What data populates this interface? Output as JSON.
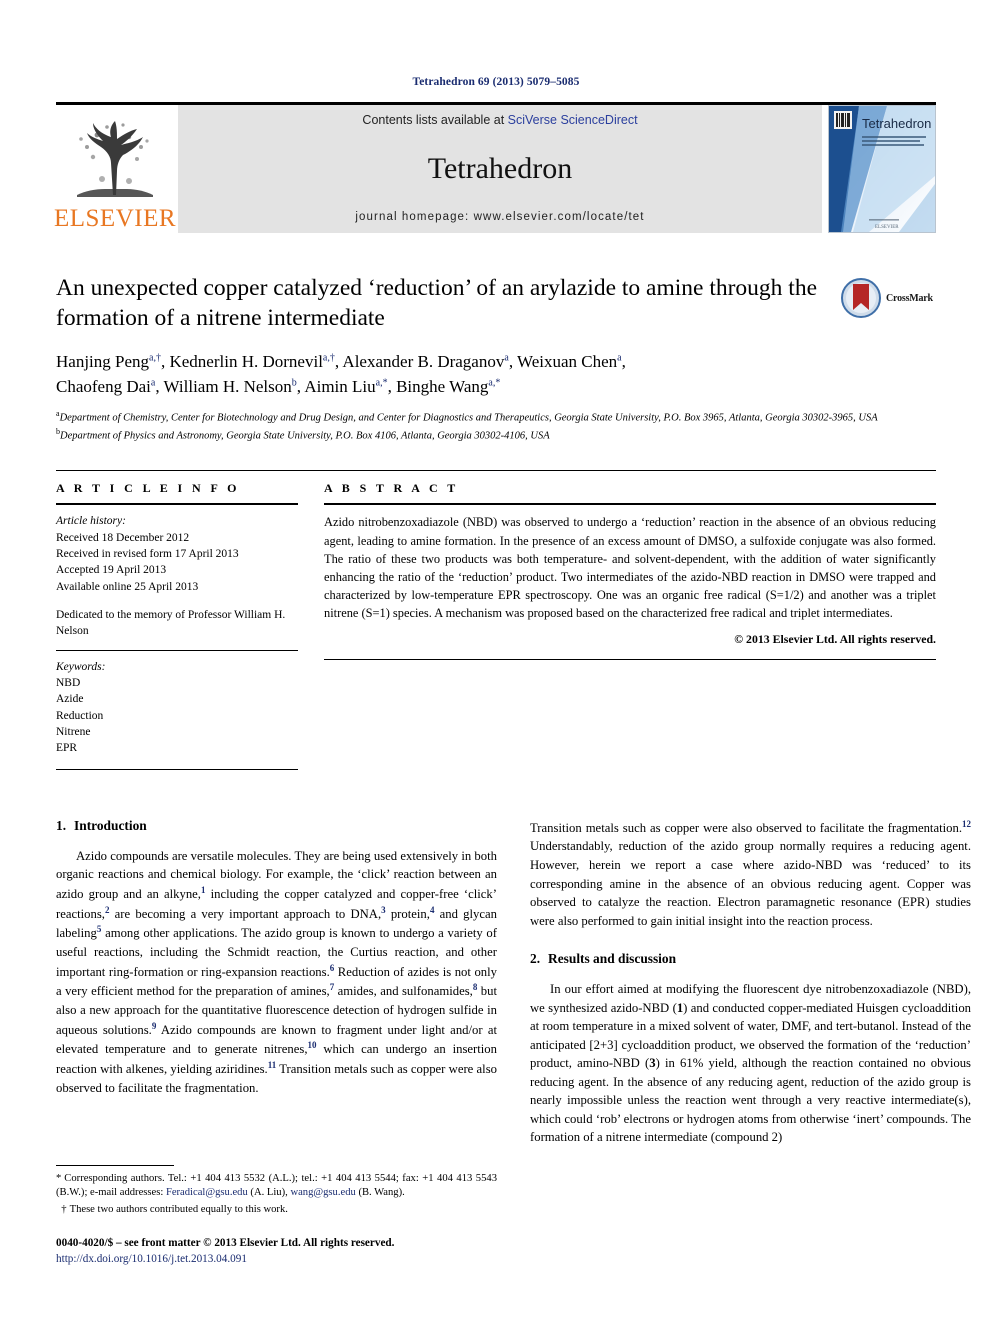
{
  "running_head": "Tetrahedron 69 (2013) 5079–5085",
  "masthead": {
    "publisher_name": "ELSEVIER",
    "contents_prefix": "Contents lists available at ",
    "contents_link": "SciVerse ScienceDirect",
    "journal_title": "Tetrahedron",
    "homepage": "journal homepage: www.elsevier.com/locate/tet",
    "cover_title": "Tetrahedron",
    "cover_subtitle": "THE INTERNATIONAL JOURNAL FOR THE RAPID PUBLICATION OF FULL ORIGINAL RESEARCH PAPERS AND CRITICAL REVIEWS IN ORGANIC CHEMISTRY",
    "cover_footer": "ELSEVIER"
  },
  "article": {
    "title": "An unexpected copper catalyzed ‘reduction’ of an arylazide to amine through the formation of a nitrene intermediate",
    "crossmark_label": "CrossMark",
    "authors_line1": "Hanjing Peng a,†, Kednerlin H. Dornevil a,†, Alexander B. Draganov a, Weixuan Chen a,",
    "authors_line2": "Chaofeng Dai a, William H. Nelson b, Aimin Liu a,*, Binghe Wang a,*",
    "affiliation_a": "a Department of Chemistry, Center for Biotechnology and Drug Design, and Center for Diagnostics and Therapeutics, Georgia State University, P.O. Box 3965, Atlanta, Georgia 30302-3965, USA",
    "affiliation_b": "b Department of Physics and Astronomy, Georgia State University, P.O. Box 4106, Atlanta, Georgia 30302-4106, USA"
  },
  "article_info": {
    "heading": "A R T I C L E   I N F O",
    "history_label": "Article history:",
    "history": [
      "Received 18 December 2012",
      "Received in revised form 17 April 2013",
      "Accepted 19 April 2013",
      "Available online 25 April 2013"
    ],
    "dedication": "Dedicated to the memory of Professor William H. Nelson",
    "keywords_label": "Keywords:",
    "keywords": [
      "NBD",
      "Azide",
      "Reduction",
      "Nitrene",
      "EPR"
    ]
  },
  "abstract": {
    "heading": "A B S T R A C T",
    "text": "Azido nitrobenzoxadiazole (NBD) was observed to undergo a ‘reduction’ reaction in the absence of an obvious reducing agent, leading to amine formation. In the presence of an excess amount of DMSO, a sulfoxide conjugate was also formed. The ratio of these two products was both temperature- and solvent-dependent, with the addition of water significantly enhancing the ratio of the ‘reduction’ product. Two intermediates of the azido-NBD reaction in DMSO were trapped and characterized by low-temperature EPR spectroscopy. One was an organic free radical (S=1/2) and another was a triplet nitrene (S=1) species. A mechanism was proposed based on the characterized free radical and triplet intermediates.",
    "copyright": "© 2013 Elsevier Ltd. All rights reserved."
  },
  "sections": {
    "intro_number": "1.",
    "intro_title": "Introduction",
    "intro_p1_a": "Azido compounds are versatile molecules. They are being used extensively in both organic reactions and chemical biology. For example, the ‘click’ reaction between an azido group and an alkyne,",
    "intro_p1_b": " including the copper catalyzed and copper-free ‘click’ reactions,",
    "intro_p1_c": " are becoming a very important approach to DNA,",
    "intro_p1_d": " protein,",
    "intro_p1_e": " and glycan labeling",
    "intro_p1_f": " among other applications. The azido group is known to undergo a variety of useful reactions, including the Schmidt reaction, the Curtius reaction, and other important ring-formation or ring-expansion reactions.",
    "intro_p1_g": " Reduction of azides is not only a very efficient method for the preparation of amines,",
    "intro_p1_h": " amides, and sulfonamides,",
    "intro_p1_i": " but also a new approach for the quantitative fluorescence detection of hydrogen sulfide in aqueous solutions.",
    "intro_p1_j": " Azido compounds are known to fragment under light and/or at elevated temperature and to generate nitrenes,",
    "intro_p1_k": " which can undergo an insertion reaction with alkenes, yielding aziridines.",
    "intro_p1_l": " Transition metals such as copper were also observed to facilitate the fragmentation.",
    "intro_p1_m": " Understandably, reduction of the azido group normally requires a reducing agent. However, herein we report a case where azido-NBD was ‘reduced’ to its corresponding amine in the absence of an obvious reducing agent. Copper was observed to catalyze the reaction. Electron paramagnetic resonance (EPR) studies were also performed to gain initial insight into the reaction process.",
    "refs": {
      "r1": "1",
      "r2": "2",
      "r3": "3",
      "r4": "4",
      "r5": "5",
      "r6": "6",
      "r7": "7",
      "r8": "8",
      "r9": "9",
      "r10": "10",
      "r11": "11",
      "r12": "12"
    },
    "results_number": "2.",
    "results_title": "Results and discussion",
    "results_p1": "In our effort aimed at modifying the fluorescent dye nitrobenzoxadiazole (NBD), we synthesized azido-NBD (1) and conducted copper-mediated Huisgen cycloaddition at room temperature in a mixed solvent of water, DMF, and tert-butanol. Instead of the anticipated [2+3] cycloaddition product, we observed the formation of the ‘reduction’ product, amino-NBD (3) in 61% yield, although the reaction contained no obvious reducing agent. In the absence of any reducing agent, reduction of the azido group is nearly impossible unless the reaction went through a very reactive intermediate(s), which could ‘rob’ electrons or hydrogen atoms from otherwise ‘inert’ compounds. The formation of a nitrene intermediate (compound 2)"
  },
  "footnotes": {
    "star_mark": "*",
    "star_text_a": "Corresponding authors. Tel.: +1 404 413 5532 (A.L.); tel.: +1 404 413 5544; fax: +1 404 413 5543 (B.W.); e-mail addresses: ",
    "email1": "Feradical@gsu.edu",
    "star_text_b": " (A. Liu), ",
    "email2": "wang@gsu.edu",
    "star_text_c": " (B. Wang).",
    "dagger_mark": "†",
    "dagger_text": "These two authors contributed equally to this work.",
    "imprint": "0040-4020/$ – see front matter © 2013 Elsevier Ltd. All rights reserved.",
    "doi": "http://dx.doi.org/10.1016/j.tet.2013.04.091"
  },
  "colors": {
    "link_blue": "#1a2c70",
    "sd_blue": "#2b3f9e",
    "elsevier_orange": "#E87722",
    "band_gray": "#e3e3e3"
  }
}
